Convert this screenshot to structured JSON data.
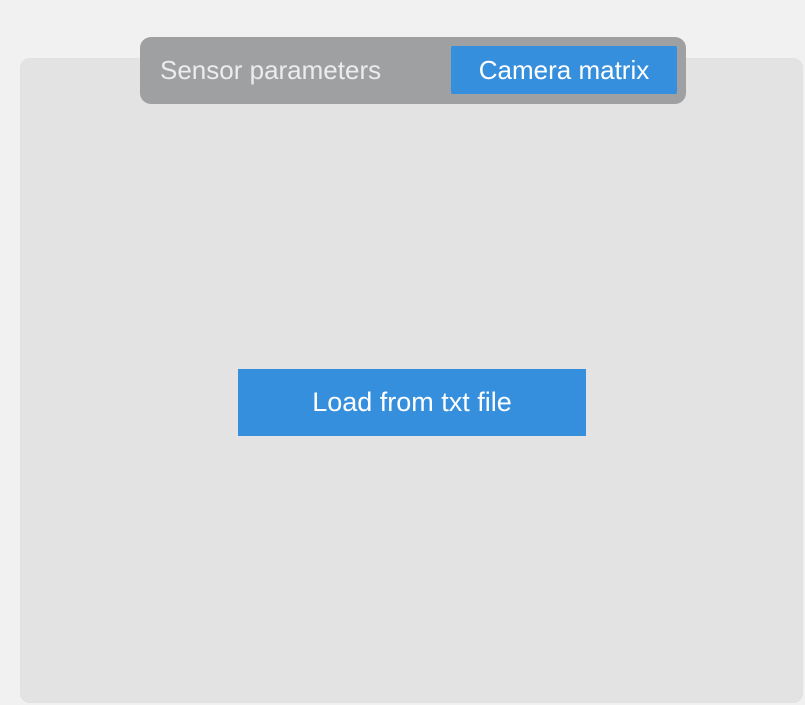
{
  "tabs": {
    "sensor_parameters": "Sensor parameters",
    "camera_matrix": "Camera matrix",
    "selected": "Camera matrix"
  },
  "panel": {
    "load_button_label": "Load from txt file"
  },
  "colors": {
    "accent": "#358fdc",
    "tab_track": "#9fa0a2",
    "panel_background": "#e3e3e3",
    "page_background": "#f1f1f1"
  }
}
